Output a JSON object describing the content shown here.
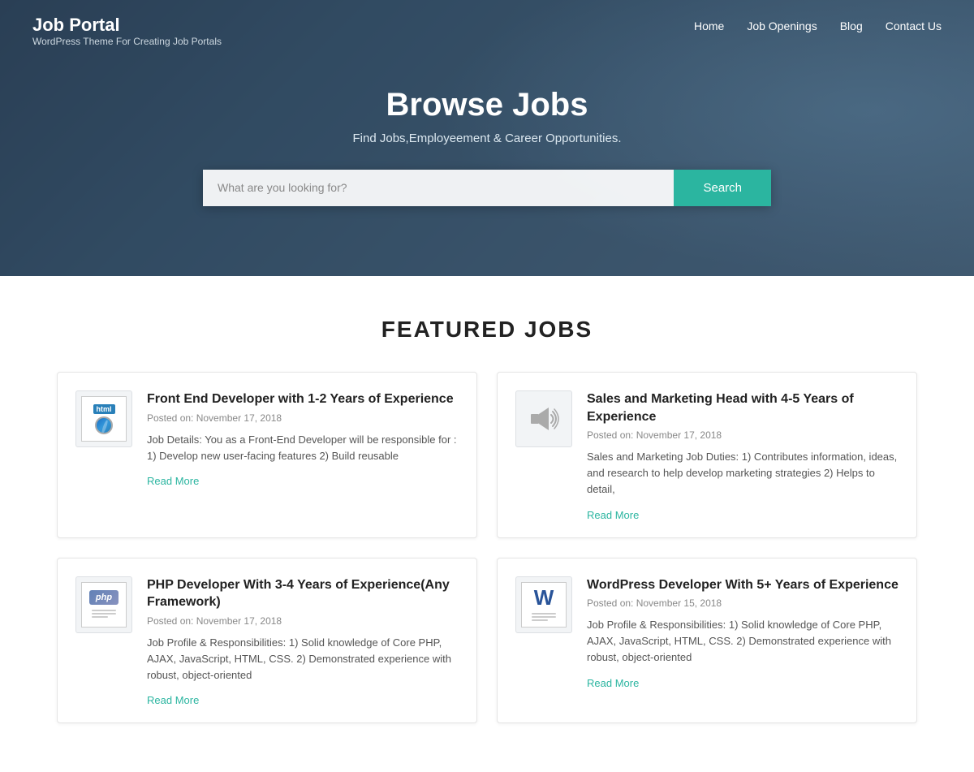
{
  "brand": {
    "title": "Job Portal",
    "subtitle": "WordPress Theme For Creating Job Portals"
  },
  "nav": {
    "links": [
      {
        "label": "Home",
        "href": "#"
      },
      {
        "label": "Job Openings",
        "href": "#"
      },
      {
        "label": "Blog",
        "href": "#"
      },
      {
        "label": "Contact Us",
        "href": "#"
      }
    ]
  },
  "hero": {
    "title": "Browse Jobs",
    "subtitle": "Find Jobs,Employeement & Career Opportunities.",
    "search_placeholder": "What are you looking for?",
    "search_button": "Search"
  },
  "featured": {
    "section_title": "FEATURED JOBS",
    "jobs": [
      {
        "id": "job-1",
        "icon_type": "html",
        "title": "Front End Developer with 1-2 Years of Experience",
        "date": "Posted on: November 17, 2018",
        "description": "Job Details: You as a Front-End Developer will be responsible for : 1) Develop new user-facing features 2) Build reusable",
        "read_more": "Read More"
      },
      {
        "id": "job-2",
        "icon_type": "speaker",
        "title": "Sales and Marketing Head with 4-5 Years of Experience",
        "date": "Posted on: November 17, 2018",
        "description": "Sales and Marketing Job Duties: 1) Contributes information, ideas, and research to help develop marketing strategies 2) Helps to detail,",
        "read_more": "Read More"
      },
      {
        "id": "job-3",
        "icon_type": "php",
        "title": "PHP Developer With 3-4 Years of Experience(Any Framework)",
        "date": "Posted on: November 17, 2018",
        "description": "Job Profile & Responsibilities: 1) Solid knowledge of Core PHP, AJAX, JavaScript, HTML, CSS. 2) Demonstrated experience with robust, object-oriented",
        "read_more": "Read More"
      },
      {
        "id": "job-4",
        "icon_type": "word",
        "title": "WordPress Developer With 5+ Years of Experience",
        "date": "Posted on: November 15, 2018",
        "description": "Job Profile & Responsibilities: 1) Solid knowledge of Core PHP, AJAX, JavaScript, HTML, CSS. 2) Demonstrated experience with robust, object-oriented",
        "read_more": "Read More"
      }
    ]
  }
}
